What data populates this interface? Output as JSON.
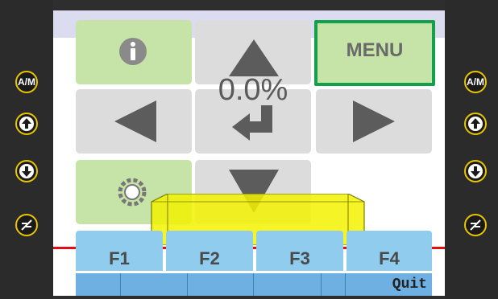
{
  "side_buttons": {
    "left": [
      {
        "name": "auto-manual-button",
        "label": "A/M"
      },
      {
        "name": "up-arrow-button",
        "icon": "arrow-up-icon"
      },
      {
        "name": "down-arrow-button",
        "icon": "arrow-down-icon"
      },
      {
        "name": "level-button",
        "icon": "level-icon"
      }
    ],
    "right": [
      {
        "name": "auto-manual-button",
        "label": "A/M"
      },
      {
        "name": "up-arrow-button",
        "icon": "arrow-up-icon"
      },
      {
        "name": "down-arrow-button",
        "icon": "arrow-down-icon"
      },
      {
        "name": "level-button",
        "icon": "level-icon"
      }
    ]
  },
  "main": {
    "menu_label": "MENU",
    "value_display": "0.0%",
    "tiles": {
      "info": "info-icon",
      "up": "arrow-up-icon",
      "left": "arrow-left-icon",
      "enter": "enter-icon",
      "right": "arrow-right-icon",
      "settings": "gear-icon",
      "down": "arrow-down-icon"
    }
  },
  "function_keys": [
    "F1",
    "F2",
    "F3",
    "F4"
  ],
  "bottom_bar": {
    "quit_label": "Quit"
  },
  "colors": {
    "tile": "#dcdcdc",
    "tile_green": "#c6e3a8",
    "menu_border": "#12a04a",
    "fkey": "#8fccee",
    "red_line": "#e01010",
    "yellow_bar": "#f0f000",
    "button_ring": "#e8c600"
  }
}
